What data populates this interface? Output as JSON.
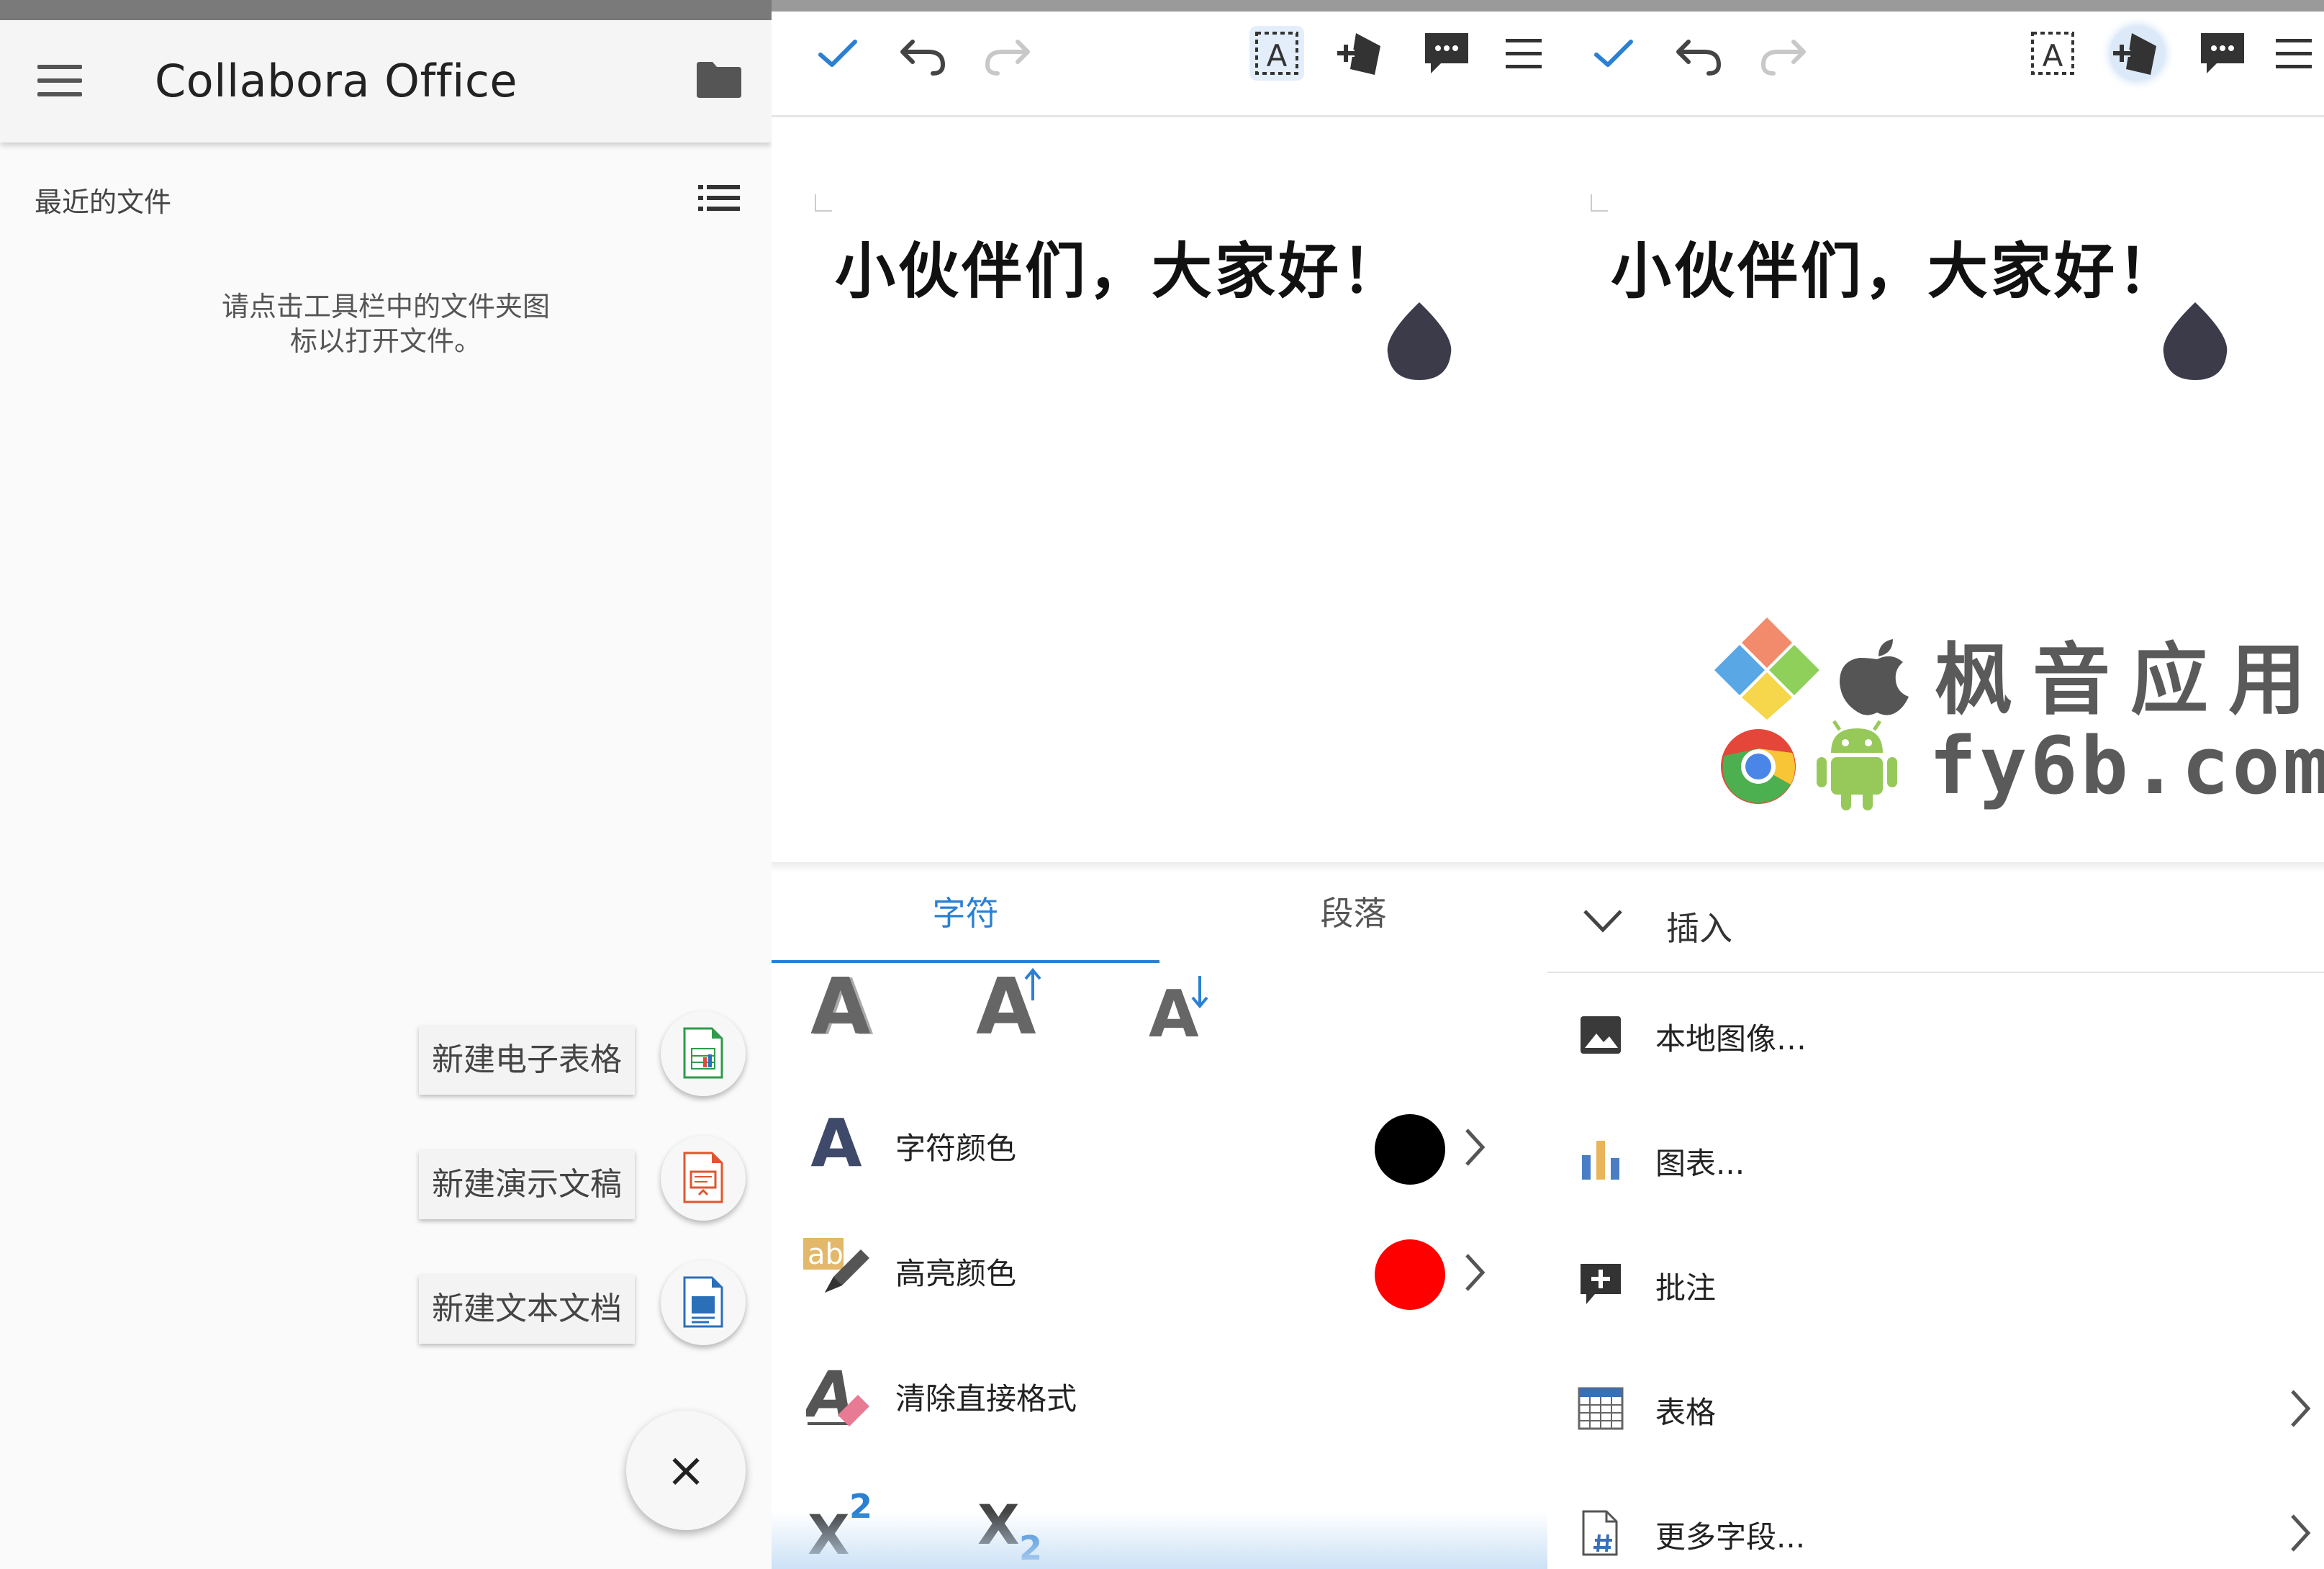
{
  "panel1": {
    "app_title": "Collabora Office",
    "recent_label": "最近的文件",
    "hint_line1": "请点击工具栏中的文件夹图",
    "hint_line2": "标以打开文件。",
    "fab_actions": [
      {
        "label": "新建电子表格",
        "icon": "spreadsheet-doc-icon",
        "color": "#2e9a4a"
      },
      {
        "label": "新建演示文稿",
        "icon": "presentation-doc-icon",
        "color": "#e0552e"
      },
      {
        "label": "新建文本文档",
        "icon": "text-doc-icon",
        "color": "#2b6fb8"
      }
    ],
    "close_glyph": "×"
  },
  "panel2": {
    "document_text": "小伙伴们，大家好！",
    "tabs": {
      "character": "字符",
      "paragraph": "段落"
    },
    "font_color_label": "字符颜色",
    "font_color": "#000000",
    "highlight_label": "高亮颜色",
    "highlight_color": "#ff0000",
    "clear_format_label": "清除直接格式",
    "grow_glyph": "A",
    "shrink_glyph": "A",
    "superscript_base": "X",
    "superscript_exp": "2",
    "subscript_base": "X",
    "subscript_exp": "2"
  },
  "panel3": {
    "document_text": "小伙伴们，大家好！",
    "insert_title": "插入",
    "items": [
      {
        "label": "本地图像…",
        "icon": "image-icon",
        "has_submenu": false
      },
      {
        "label": "图表...",
        "icon": "chart-icon",
        "has_submenu": false
      },
      {
        "label": "批注",
        "icon": "add-comment-icon",
        "has_submenu": false
      },
      {
        "label": "表格",
        "icon": "table-icon",
        "has_submenu": true
      },
      {
        "label": "更多字段...",
        "icon": "field-icon",
        "has_submenu": true
      }
    ]
  },
  "watermark": {
    "line1": "枫音应用",
    "line2": "fy6b.com"
  },
  "colors": {
    "accent": "#2b80d4",
    "icon_dark": "#3b3b4a"
  }
}
